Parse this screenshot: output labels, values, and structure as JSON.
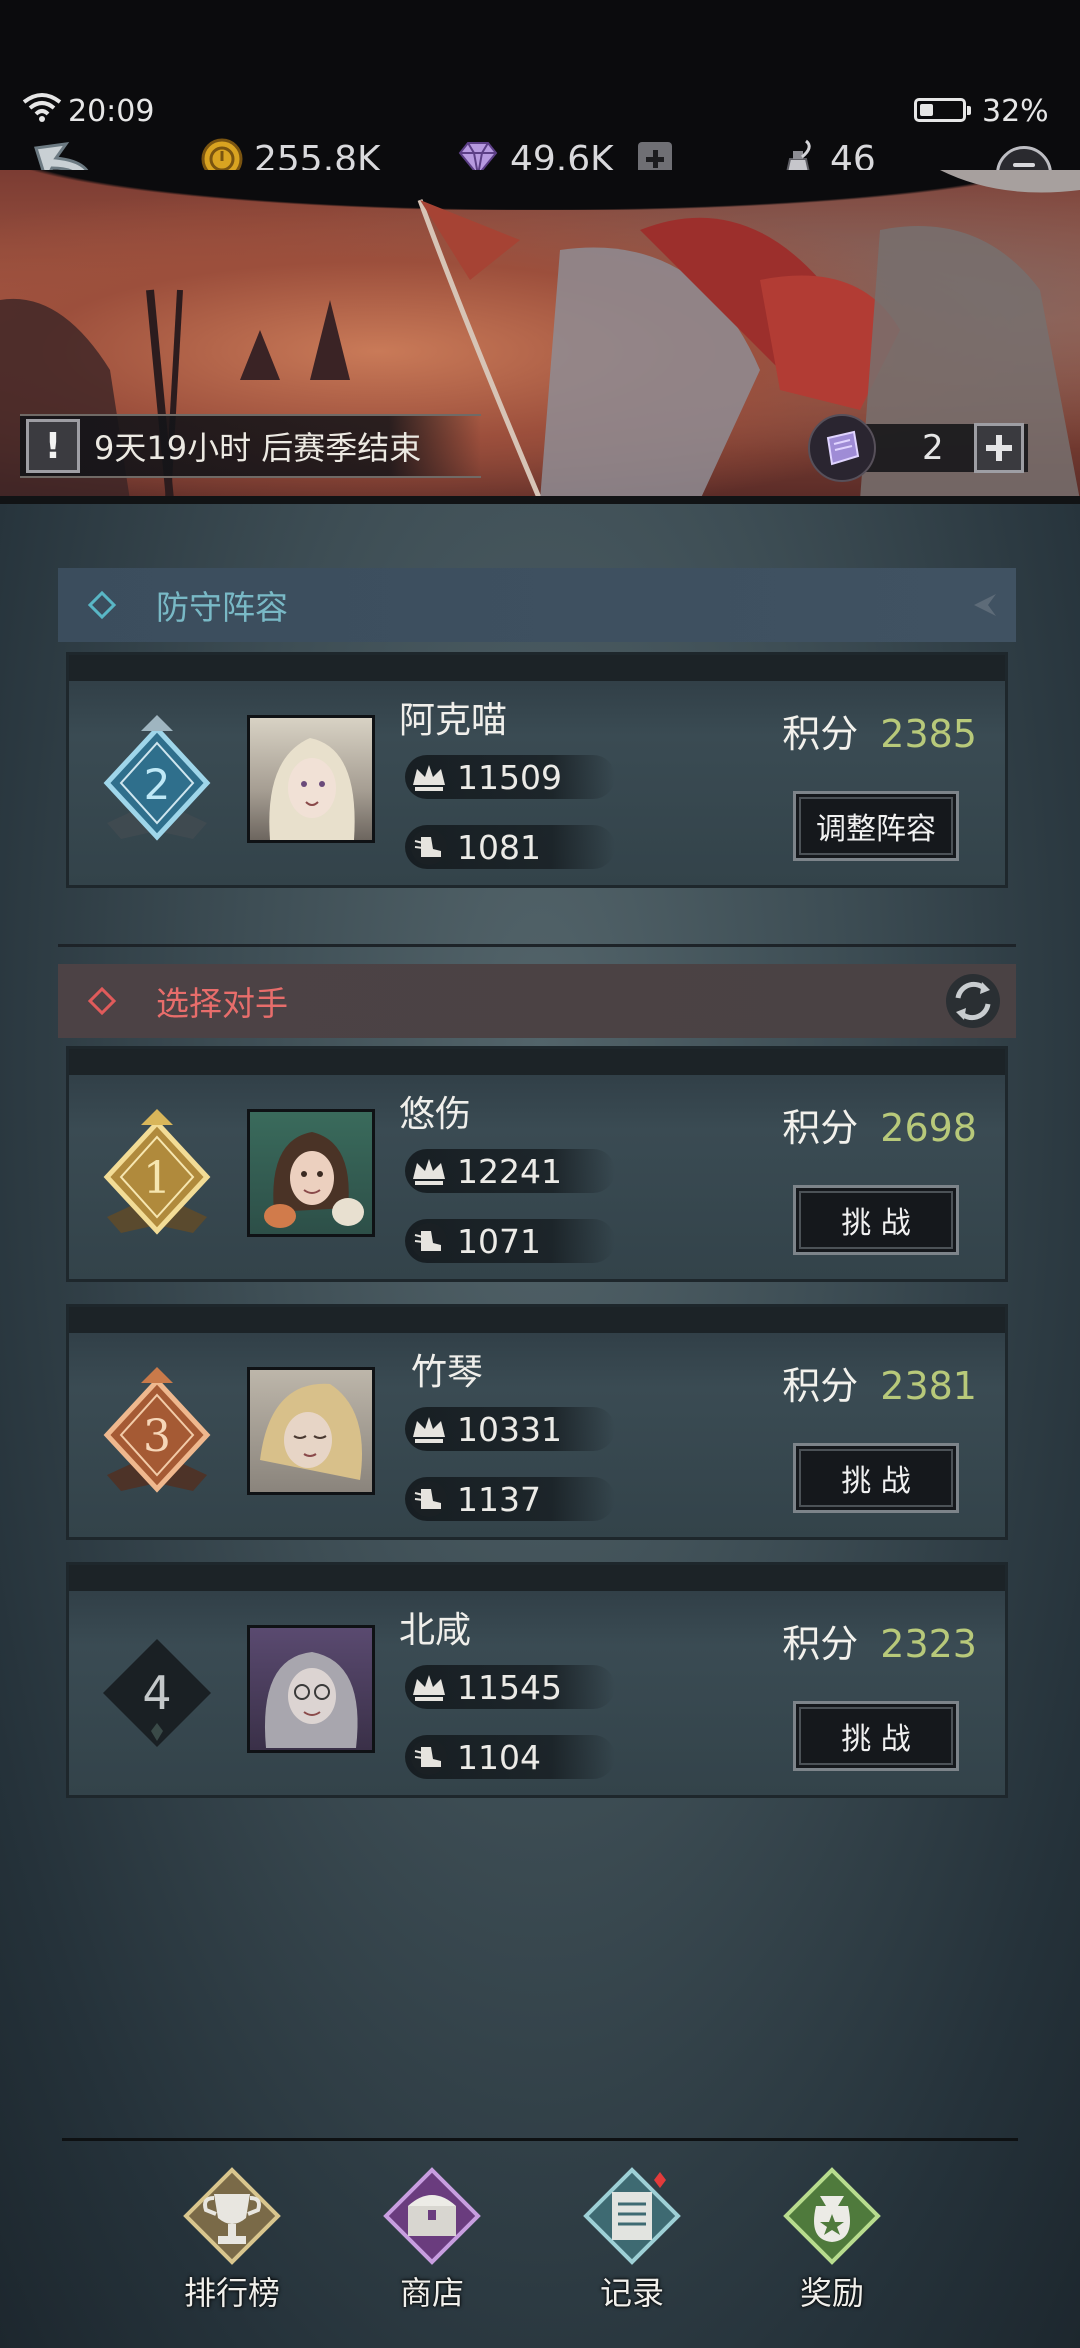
{
  "status_bar": {
    "time": "20:09",
    "battery": "32%",
    "battery_level": 0.32
  },
  "resources": {
    "gold": "255.8K",
    "gems": "49.6K",
    "ink": "46"
  },
  "banner": {
    "season_text": "9天19小时 后赛季结束",
    "ticket_count": "2"
  },
  "defense": {
    "title": "防守阵容",
    "player": {
      "rank": "2",
      "name": "阿克喵",
      "power": "11509",
      "speed": "1081",
      "score_label": "积分",
      "score": "2385",
      "button": "调整阵容"
    }
  },
  "opponents": {
    "title": "选择对手",
    "list": [
      {
        "rank": "1",
        "name": "悠伤",
        "power": "12241",
        "speed": "1071",
        "score_label": "积分",
        "score": "2698",
        "button": "挑 战"
      },
      {
        "rank": "3",
        "name": "竹琴",
        "power": "10331",
        "speed": "1137",
        "score_label": "积分",
        "score": "2381",
        "button": "挑 战"
      },
      {
        "rank": "4",
        "name": "北咸",
        "power": "11545",
        "speed": "1104",
        "score_label": "积分",
        "score": "2323",
        "button": "挑 战"
      }
    ]
  },
  "nav": {
    "items": [
      {
        "label": "排行榜",
        "icon": "trophy-icon"
      },
      {
        "label": "商店",
        "icon": "treasure-chest-icon"
      },
      {
        "label": "记录",
        "icon": "scroll-record-icon"
      },
      {
        "label": "奖励",
        "icon": "reward-bag-icon"
      }
    ]
  },
  "colors": {
    "score_value": "#b8c97a",
    "defense_accent": "#79b9c6",
    "opponent_accent": "#e86d6b",
    "gold_rank": "#d9b65a",
    "bronze_rank": "#c97a4a",
    "silver_rank": "#5aa6c8"
  }
}
